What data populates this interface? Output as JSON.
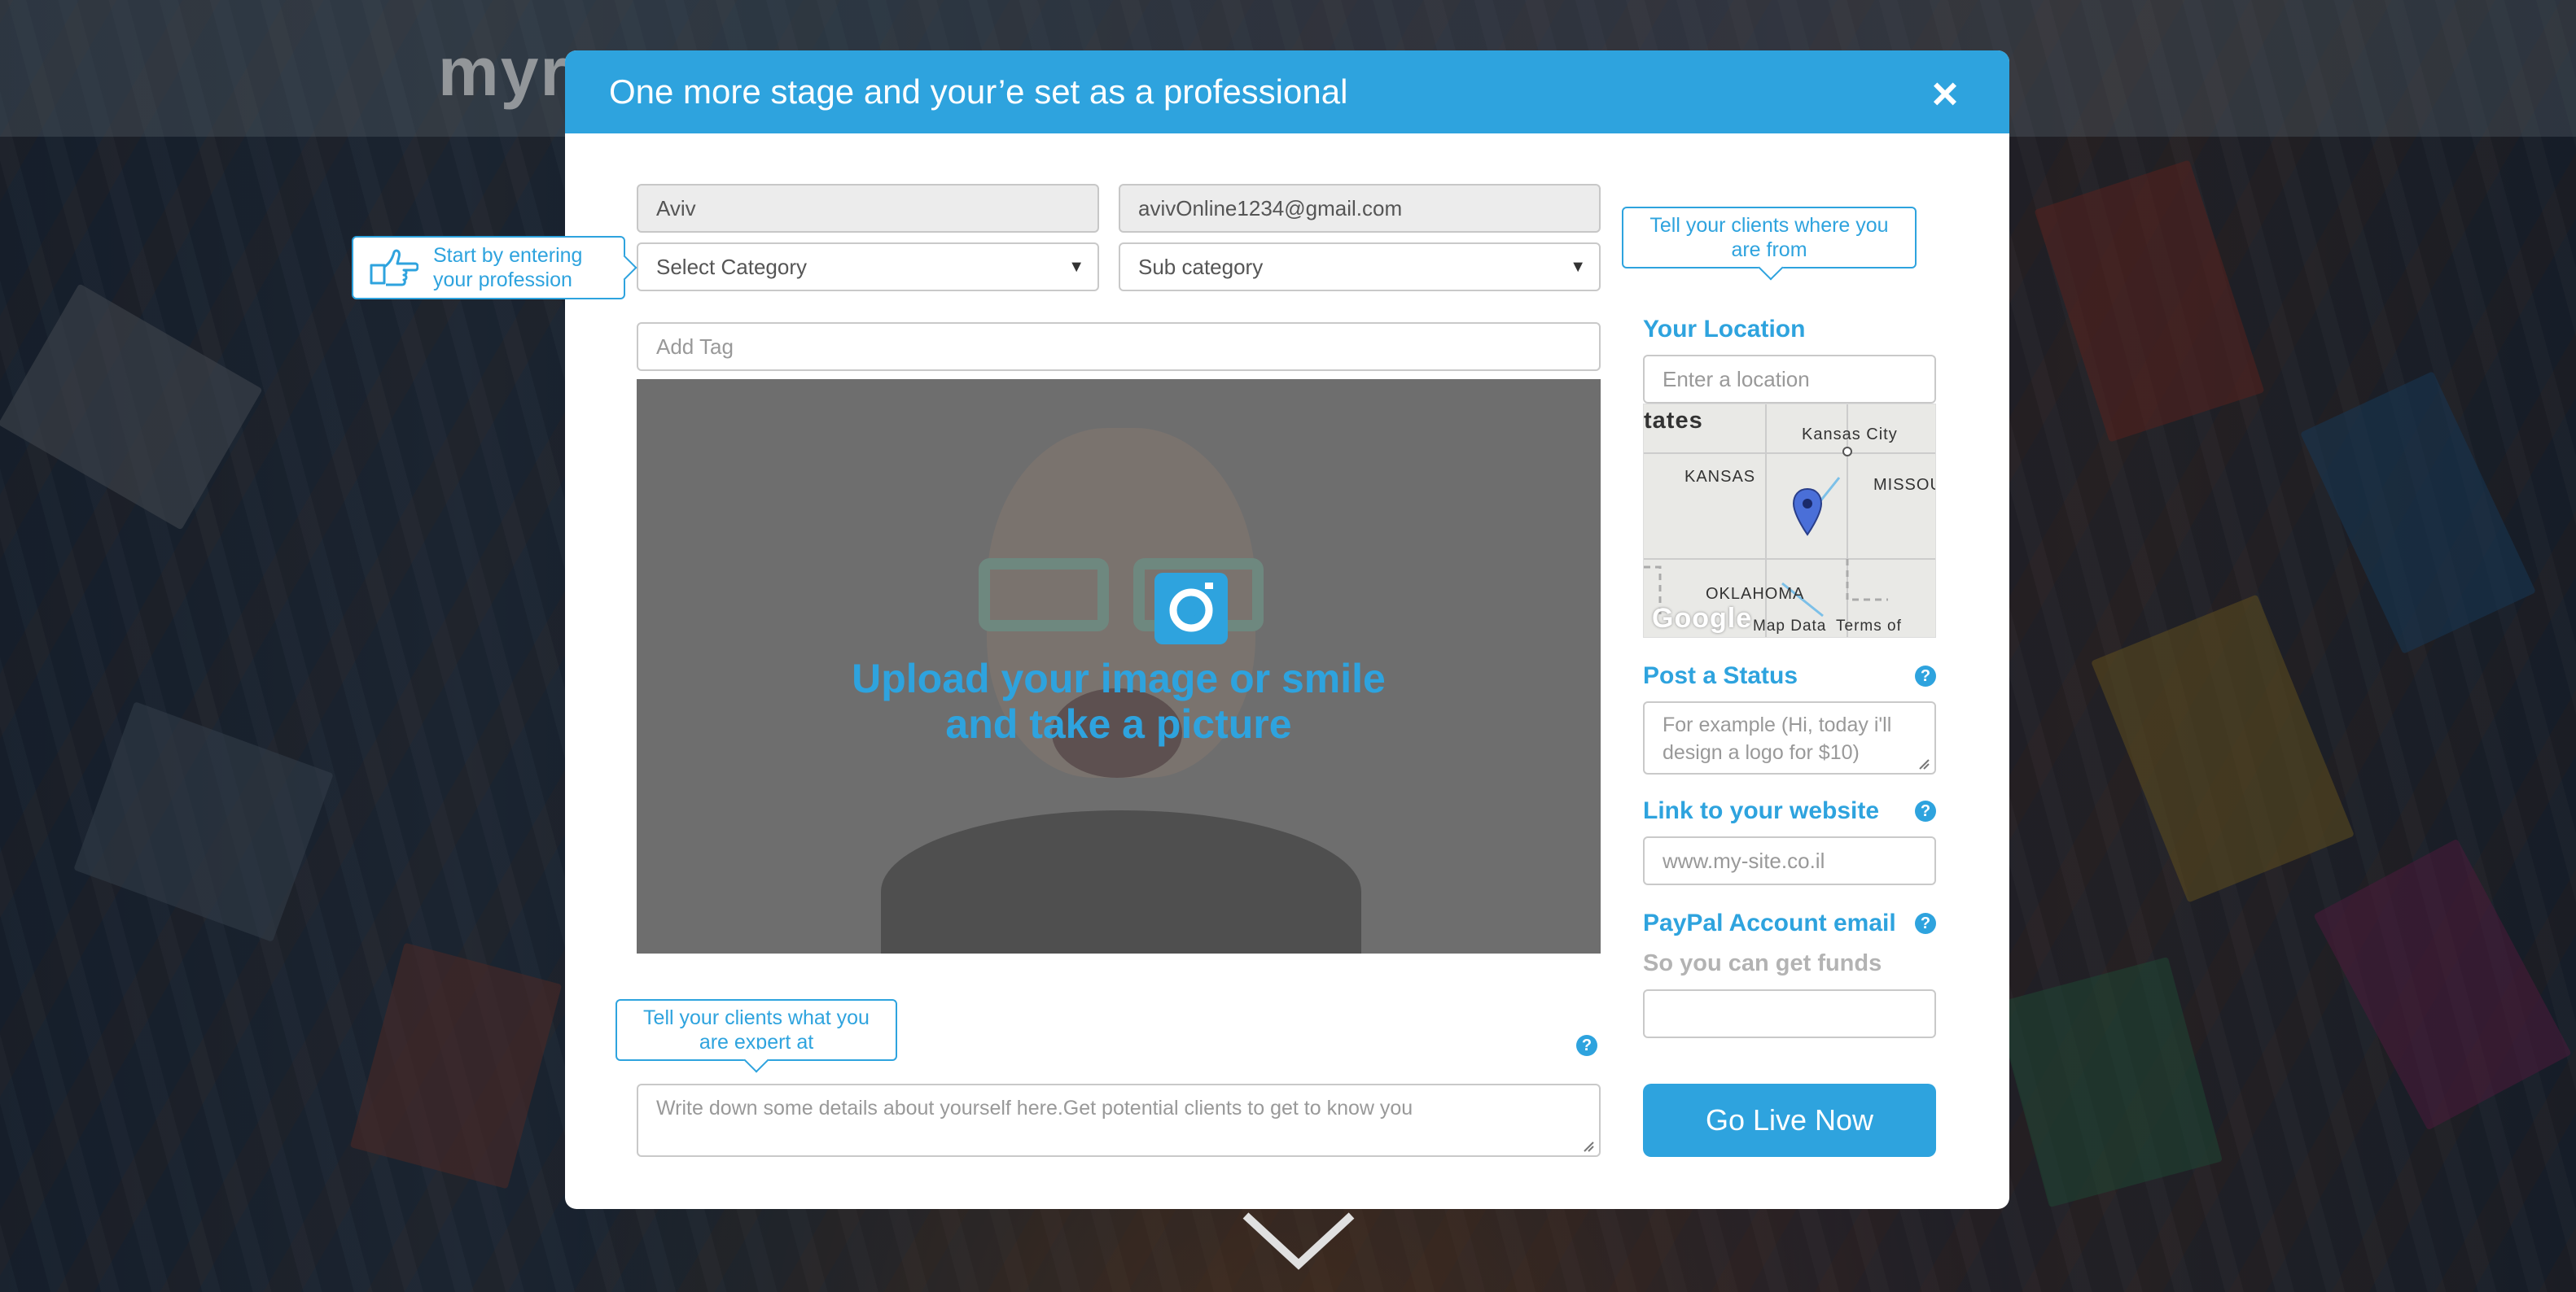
{
  "background": {
    "logo_text": "myr..."
  },
  "modal": {
    "title": "One more stage and your’e set as a professional",
    "close_icon": "×"
  },
  "form": {
    "name_value": "Aviv",
    "email_value": "avivOnline1234@gmail.com",
    "category_value": "Select Category",
    "subcategory_value": "Sub category",
    "tag_placeholder": "Add Tag",
    "about_placeholder": "Write down some details about yourself here.Get potential clients to get to know you"
  },
  "upload": {
    "line1": "Upload your image or smile",
    "line2": "and take a picture",
    "icon": "camera-icon"
  },
  "tooltips": {
    "profession_line1": "Start by entering",
    "profession_line2": "your profession",
    "location_line1": "Tell your clients where you",
    "location_line2": "are from",
    "expert_line1": "Tell your clients what you",
    "expert_line2": "are expert at"
  },
  "right_column": {
    "location_label": "Your Location",
    "location_placeholder": "Enter a location",
    "status_label": "Post a Status",
    "status_placeholder": "For example (Hi, today i'll design a logo for $10)",
    "website_label": "Link to your website",
    "website_placeholder": "www.my-site.co.il",
    "paypal_label": "PayPal Account email",
    "paypal_sub": "So you can get funds",
    "paypal_value": "",
    "go_live_label": "Go Live Now",
    "help_glyph": "?"
  },
  "map": {
    "labels": {
      "states": "tates",
      "kansas_city": "Kansas City",
      "kansas": "KANSAS",
      "missouri": "MISSOU",
      "oklahoma": "OKLAHOMA",
      "google": "Google",
      "map_data": "Map Data",
      "terms": "Terms of Use"
    }
  },
  "colors": {
    "accent": "#2ea3de",
    "header_text": "#ffffff",
    "muted": "#999999"
  }
}
